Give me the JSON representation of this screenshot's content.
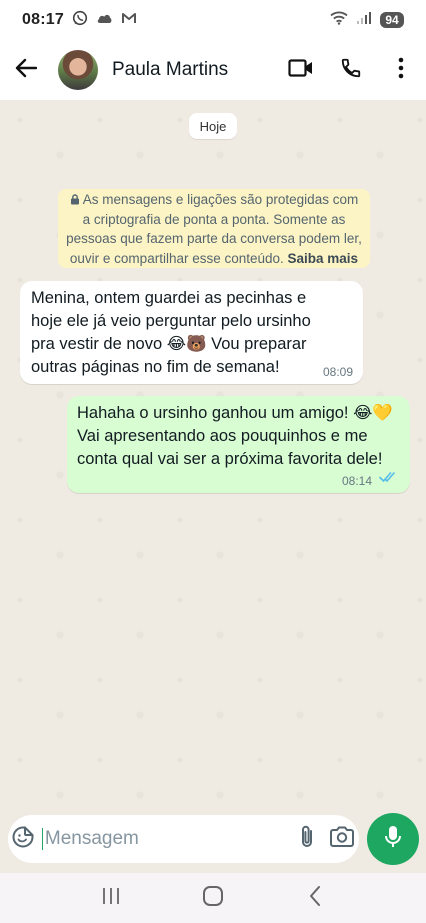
{
  "status_bar": {
    "time": "08:17",
    "notification_icons": [
      "whatsapp-icon",
      "cloud-icon",
      "gmail-icon"
    ],
    "battery": "94"
  },
  "header": {
    "contact_name": "Paula Martins",
    "icons": [
      "back-arrow-icon",
      "video-call-icon",
      "phone-icon",
      "more-vert-icon"
    ]
  },
  "chat": {
    "date_chip": "Hoje",
    "encryption_notice": {
      "text": "As mensagens e ligações são protegidas com a criptografia de ponta a ponta. Somente as pessoas que fazem parte da conversa podem ler, ouvir e compartilhar esse conteúdo. ",
      "link": "Saiba mais"
    },
    "messages": [
      {
        "direction": "incoming",
        "text": "Menina, ontem guardei as pecinhas e\nhoje ele já veio perguntar pelo ursinho\npra vestir de novo 😂🐻 Vou preparar\noutras páginas no fim de semana!",
        "time": "08:09"
      },
      {
        "direction": "outgoing",
        "text": "Hahaha o ursinho ganhou um amigo! 😂💛\nVai apresentando aos pouquinhos e me\nconta qual vai ser a próxima favorita dele!",
        "time": "08:14",
        "status": "read"
      }
    ]
  },
  "composer": {
    "placeholder": "Mensagem"
  },
  "colors": {
    "accent": "#1da761",
    "outgoing_bubble": "#d9fdd3",
    "incoming_bubble": "#ffffff",
    "chat_background": "#efeae2",
    "encryption_background": "#fdf4c5",
    "read_ticks": "#53bdeb"
  }
}
